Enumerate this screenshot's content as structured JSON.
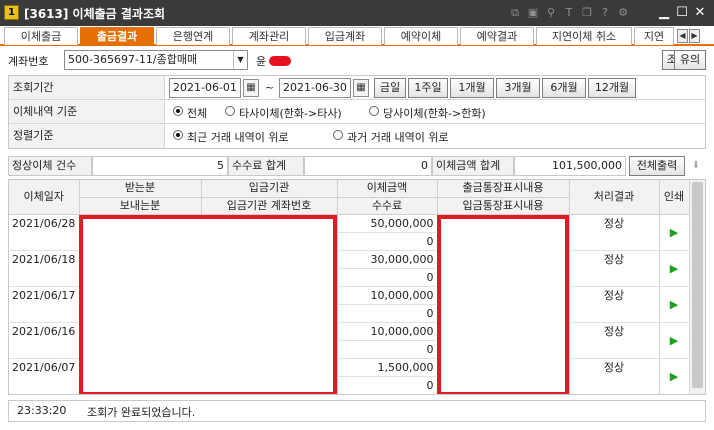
{
  "window": {
    "icon_label": "1",
    "title": "[3613] 이체출금 결과조회"
  },
  "tabs": [
    {
      "label": "이체출금",
      "active": false
    },
    {
      "label": "출금결과",
      "active": true
    },
    {
      "label": "은행연계",
      "active": false
    },
    {
      "label": "계좌관리",
      "active": false
    },
    {
      "label": "입금계좌",
      "active": false
    },
    {
      "label": "예약이체",
      "active": false
    },
    {
      "label": "예약결과",
      "active": false
    },
    {
      "label": "지연이체 취소",
      "active": false
    },
    {
      "label": "지연",
      "active": false
    }
  ],
  "account": {
    "label": "계좌번호",
    "value": "500-365697-11/종합매매",
    "owner_initial": "윤",
    "query_button": "조회",
    "note_button": "유의"
  },
  "conditions": {
    "period_label": "조회기간",
    "date_from": "2021-06-01",
    "range_sep": "~",
    "date_to": "2021-06-30",
    "period_buttons": [
      "금일",
      "1주일",
      "1개월",
      "3개월",
      "6개월",
      "12개월"
    ],
    "criteria_label": "이체내역 기준",
    "criteria_options": [
      "전체",
      "타사이체(한화->타사)",
      "당사이체(한화->한화)"
    ],
    "criteria_selected": 0,
    "sort_label": "정렬기준",
    "sort_options": [
      "최근 거래 내역이 위로",
      "과거 거래 내역이 위로"
    ],
    "sort_selected": 0
  },
  "summary": {
    "count_label": "정상이체 건수",
    "count_value": "5",
    "fee_label": "수수료 합계",
    "fee_value": "0",
    "amount_label": "이체금액 합계",
    "amount_value": "101,500,000",
    "print_button": "전체출력"
  },
  "grid": {
    "headers_top": [
      "이체일자",
      "받는분",
      "입금기관",
      "이체금액",
      "출금통장표시내용",
      "처리결과",
      "인쇄"
    ],
    "headers_bottom": [
      "보내는분",
      "입금기관 계좌번호",
      "수수료",
      "입금통장표시내용"
    ],
    "rows": [
      {
        "date": "2021/06/28",
        "amount": "50,000,000",
        "fee": "0",
        "result": "정상"
      },
      {
        "date": "2021/06/18",
        "amount": "30,000,000",
        "fee": "0",
        "result": "정상"
      },
      {
        "date": "2021/06/17",
        "amount": "10,000,000",
        "fee": "0",
        "result": "정상"
      },
      {
        "date": "2021/06/16",
        "amount": "10,000,000",
        "fee": "0",
        "result": "정상"
      },
      {
        "date": "2021/06/07",
        "amount": "1,500,000",
        "fee": "0",
        "result": "정상"
      }
    ]
  },
  "status": {
    "time": "23:33:20",
    "message": "조회가 완료되었습니다."
  },
  "colors": {
    "accent": "#e56f00",
    "redaction": "#e21b22",
    "print_arrow": "#19a21a"
  }
}
